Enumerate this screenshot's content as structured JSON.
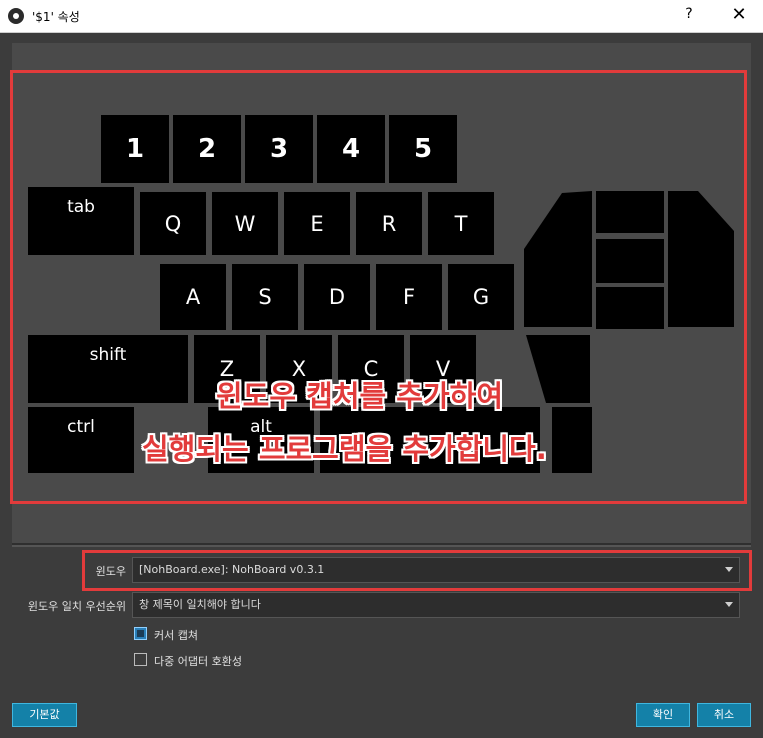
{
  "window": {
    "title": "'$1' 속성",
    "help": "?",
    "close": "✕"
  },
  "preview": {
    "keys": {
      "num": [
        "1",
        "2",
        "3",
        "4",
        "5"
      ],
      "row1": [
        "tab",
        "Q",
        "W",
        "E",
        "R",
        "T"
      ],
      "row2": [
        "A",
        "S",
        "D",
        "F",
        "G"
      ],
      "row3": [
        "shift",
        "Z",
        "X",
        "C",
        "V"
      ],
      "row4": [
        "ctrl",
        "alt"
      ]
    },
    "overlay": [
      "윈도우 캡처를 추가하여",
      "실행되는 프로그램을 추가합니다."
    ]
  },
  "form": {
    "window_label": "윈도우",
    "window_value": "[NohBoard.exe]: NohBoard v0.3.1",
    "priority_label": "윈도우 일치 우선순위",
    "priority_value": "창 제목이 일치해야 합니다",
    "capture_cursor": {
      "label": "커서 캡쳐",
      "checked": true
    },
    "multi_adapter": {
      "label": "다중 어댑터 호환성",
      "checked": false
    }
  },
  "buttons": {
    "defaults": "기본값",
    "ok": "확인",
    "cancel": "취소"
  },
  "colors": {
    "highlight": "#e23b3b",
    "accent": "#1481a8"
  }
}
